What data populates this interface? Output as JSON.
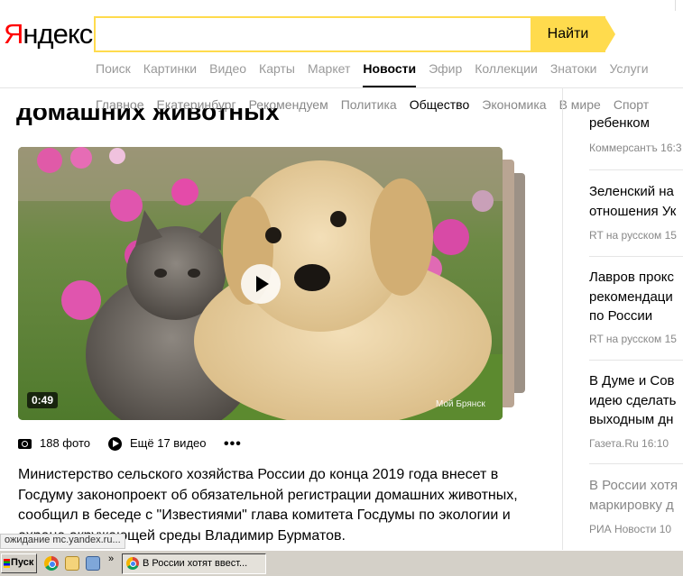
{
  "header": {
    "logo": "Яндекс",
    "search_value": "",
    "search_button": "Найти"
  },
  "services": [
    "Поиск",
    "Картинки",
    "Видео",
    "Карты",
    "Маркет",
    "Новости",
    "Эфир",
    "Коллекции",
    "Знатоки",
    "Услуги"
  ],
  "services_active": "Новости",
  "rubrics": [
    "Главное",
    "Екатеринбург",
    "Рекомендуем",
    "Политика",
    "Общество",
    "Экономика",
    "В мире",
    "Спорт"
  ],
  "rubrics_active": "Общество",
  "article": {
    "title_cut": "домашних животных",
    "video_duration": "0:49",
    "media_credit": "Мой Брянск",
    "photos_count": "188 фото",
    "more_videos": "Ещё 17 видео",
    "lead": "Министерство сельского хозяйства России до конца 2019 года внесет в Госдуму законопроект об обязательной регистрации домашних животных, сообщил в беседе с \"Известиями\" глава комитета Госдумы по экологии и охране окружающей среды Владимир Бурматов."
  },
  "side_news": [
    {
      "lines": [
        "ребенком"
      ],
      "source": "Коммерсантъ 16:3"
    },
    {
      "lines": [
        "Зеленский на",
        "отношения Ук"
      ],
      "source": "RT на русском 15"
    },
    {
      "lines": [
        "Лавров прокс",
        "рекомендаци",
        "по России"
      ],
      "source": "RT на русском 15"
    },
    {
      "lines": [
        "В Думе и Сов",
        "идею сделать",
        "выходным дн"
      ],
      "source": "Газета.Ru 16:10"
    },
    {
      "lines": [
        "В России хотя",
        "маркировку д"
      ],
      "source": "РИА Новости 10",
      "muted": true
    }
  ],
  "status_text": "ожидание mc.yandex.ru...",
  "taskbar": {
    "start_label": "Пуск",
    "window_title": "В России хотят ввест...",
    "chevron": "»"
  },
  "colors": {
    "brand_yellow": "#ffdb4d",
    "logo_red": "#ff0000"
  }
}
